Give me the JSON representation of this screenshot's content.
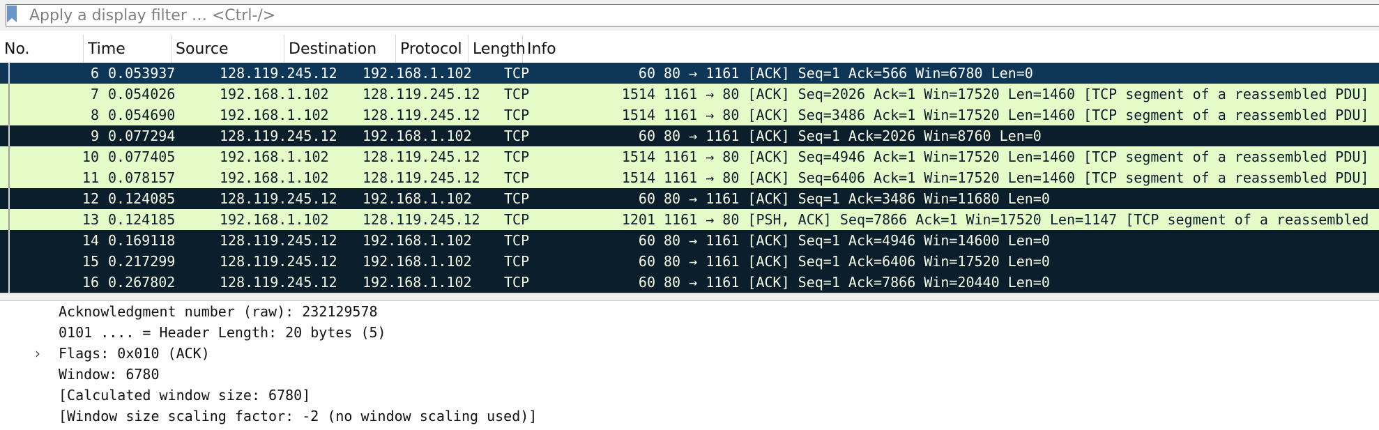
{
  "filter": {
    "placeholder": "Apply a display filter … <Ctrl-/>"
  },
  "columns": [
    "No.",
    "Time",
    "Source",
    "Destination",
    "Protocol",
    "Length",
    "Info"
  ],
  "packets": [
    {
      "no": "6",
      "time": "0.053937",
      "src": "128.119.245.12",
      "dst": "192.168.1.102",
      "proto": "TCP",
      "len": "60",
      "info": "80 → 1161 [ACK] Seq=1 Ack=566 Win=6780 Len=0",
      "style": "selected"
    },
    {
      "no": "7",
      "time": "0.054026",
      "src": "192.168.1.102",
      "dst": "128.119.245.12",
      "proto": "TCP",
      "len": "1514",
      "info": "1161 → 80 [ACK] Seq=2026 Ack=1 Win=17520 Len=1460 [TCP segment of a reassembled PDU]",
      "style": "light"
    },
    {
      "no": "8",
      "time": "0.054690",
      "src": "192.168.1.102",
      "dst": "128.119.245.12",
      "proto": "TCP",
      "len": "1514",
      "info": "1161 → 80 [ACK] Seq=3486 Ack=1 Win=17520 Len=1460 [TCP segment of a reassembled PDU]",
      "style": "light"
    },
    {
      "no": "9",
      "time": "0.077294",
      "src": "128.119.245.12",
      "dst": "192.168.1.102",
      "proto": "TCP",
      "len": "60",
      "info": "80 → 1161 [ACK] Seq=1 Ack=2026 Win=8760 Len=0",
      "style": "dark"
    },
    {
      "no": "10",
      "time": "0.077405",
      "src": "192.168.1.102",
      "dst": "128.119.245.12",
      "proto": "TCP",
      "len": "1514",
      "info": "1161 → 80 [ACK] Seq=4946 Ack=1 Win=17520 Len=1460 [TCP segment of a reassembled PDU]",
      "style": "light"
    },
    {
      "no": "11",
      "time": "0.078157",
      "src": "192.168.1.102",
      "dst": "128.119.245.12",
      "proto": "TCP",
      "len": "1514",
      "info": "1161 → 80 [ACK] Seq=6406 Ack=1 Win=17520 Len=1460 [TCP segment of a reassembled PDU]",
      "style": "light"
    },
    {
      "no": "12",
      "time": "0.124085",
      "src": "128.119.245.12",
      "dst": "192.168.1.102",
      "proto": "TCP",
      "len": "60",
      "info": "80 → 1161 [ACK] Seq=1 Ack=3486 Win=11680 Len=0",
      "style": "dark"
    },
    {
      "no": "13",
      "time": "0.124185",
      "src": "192.168.1.102",
      "dst": "128.119.245.12",
      "proto": "TCP",
      "len": "1201",
      "info": "1161 → 80 [PSH, ACK] Seq=7866 Ack=1 Win=17520 Len=1147 [TCP segment of a reassembled",
      "style": "light"
    },
    {
      "no": "14",
      "time": "0.169118",
      "src": "128.119.245.12",
      "dst": "192.168.1.102",
      "proto": "TCP",
      "len": "60",
      "info": "80 → 1161 [ACK] Seq=1 Ack=4946 Win=14600 Len=0",
      "style": "dark"
    },
    {
      "no": "15",
      "time": "0.217299",
      "src": "128.119.245.12",
      "dst": "192.168.1.102",
      "proto": "TCP",
      "len": "60",
      "info": "80 → 1161 [ACK] Seq=1 Ack=6406 Win=17520 Len=0",
      "style": "dark"
    },
    {
      "no": "16",
      "time": "0.267802",
      "src": "128.119.245.12",
      "dst": "192.168.1.102",
      "proto": "TCP",
      "len": "60",
      "info": "80 → 1161 [ACK] Seq=1 Ack=7866 Win=20440 Len=0",
      "style": "dark"
    }
  ],
  "details": [
    "Acknowledgment number (raw): 232129578",
    "0101 .... = Header Length: 20 bytes (5)",
    "Flags: 0x010 (ACK)",
    "Window: 6780",
    "[Calculated window size: 6780]",
    "[Window size scaling factor: -2 (no window scaling used)]"
  ],
  "icons": {
    "bookmark": "bookmark-icon",
    "expander": "chevron-right-icon"
  },
  "colors": {
    "selected_row": "#0e3657",
    "tcp_light": "#e6fcc8",
    "tcp_dark": "#0a1f2b",
    "bookmark": "#6e95c7"
  }
}
